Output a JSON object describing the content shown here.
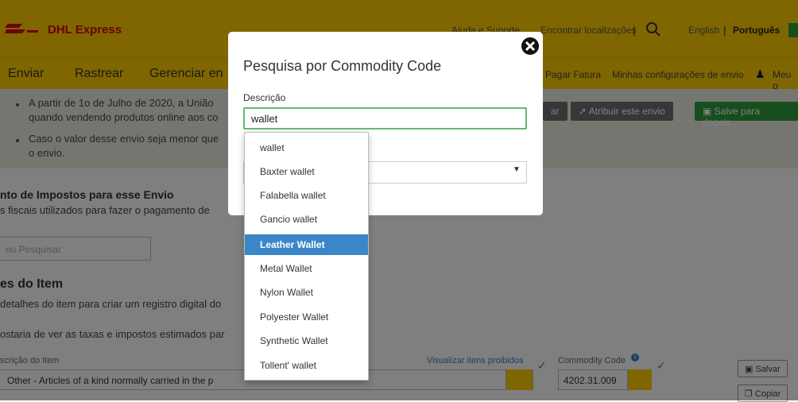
{
  "header": {
    "brand": "DHL Express",
    "links": [
      "Ajuda e Suporte",
      "Encontrar localizações"
    ],
    "languages": [
      "English",
      "Português"
    ],
    "colors": {
      "brand_yellow": "#ffcc00",
      "brand_red": "#d40511",
      "accent_green": "#2e9d3a"
    }
  },
  "nav": {
    "items": [
      "Enviar",
      "Rastrear",
      "Gerenciar en"
    ],
    "right_items": [
      "Pagar Fatura",
      "Minhas configurações de envio",
      "Meu p"
    ]
  },
  "notice": {
    "line1": "A partir de 1o de Julho de 2020, a União",
    "line1b": "quando vendendo produtos online aos co",
    "line2": "Caso o valor desse envio seja menor que",
    "line2b": "o envio.",
    "buttons": [
      "ar",
      "Atribuir este envio",
      "Salve para depois"
    ]
  },
  "tax": {
    "title": "nto de Impostos para esse Envio",
    "subtitle": "s fiscais utilizados para fazer o pagamento de",
    "input_placeholder": "ou Pesquisar"
  },
  "item": {
    "title": "es do Item",
    "subtitle": "detalhes do item para criar um registro digital do",
    "subtitle2": "ostaria de ver as taxas e impostos estimados par",
    "desc_label": "scrição do Item",
    "prohibited_link": "Visualizar itens proibidos",
    "desc_value": "Other - Articles of a kind normally carried in the p",
    "cc_label": "Commodity Code",
    "cc_value": "4202.31.009",
    "save_button": "Salvar",
    "copy_button": "Copiar"
  },
  "modal": {
    "title": "Pesquisa por Commodity Code",
    "field_label": "Descrição",
    "field_value": "wallet"
  },
  "autocomplete": {
    "options": [
      "wallet",
      "Baxter wallet",
      "Falabella wallet",
      "Gancio wallet",
      "Leather Wallet",
      "Metal Wallet",
      "Nylon Wallet",
      "Polyester Wallet",
      "Synthetic Wallet",
      "Tollent' wallet"
    ],
    "highlighted": "Leather Wallet",
    "highlight_color": "#3a86c8"
  }
}
